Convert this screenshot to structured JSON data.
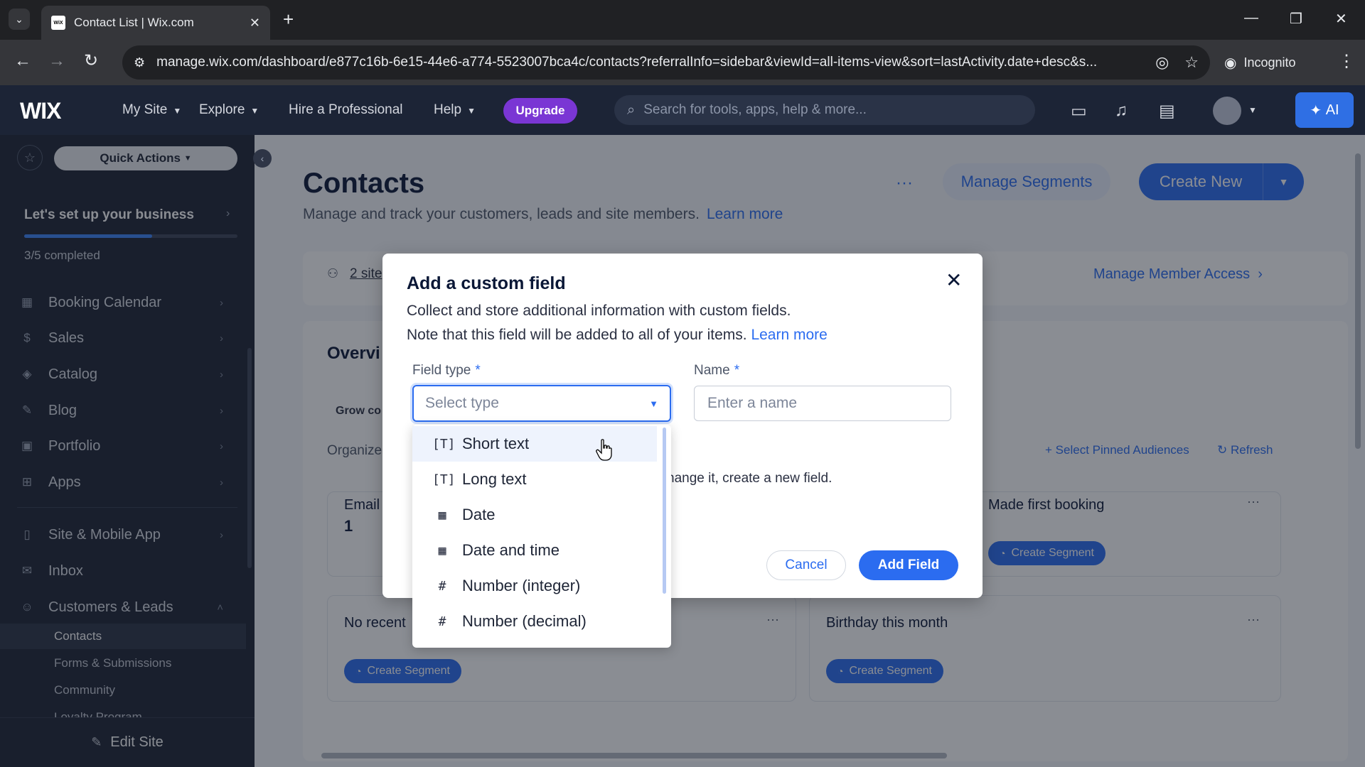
{
  "browser": {
    "tab_title": "Contact List | Wix.com",
    "favicon_text": "WiX",
    "url": "manage.wix.com/dashboard/e877c16b-6e15-44e6-a774-5523007bca4c/contacts?referralInfo=sidebar&viewId=all-items-view&sort=lastActivity.date+desc&s...",
    "incognito_label": "Incognito"
  },
  "topbar": {
    "logo": "WIX",
    "menu": [
      "My Site",
      "Explore",
      "Hire a Professional",
      "Help"
    ],
    "upgrade_label": "Upgrade",
    "search_placeholder": "Search for tools, apps, help & more...",
    "ai_label": "AI"
  },
  "sidebar": {
    "quick_actions": "Quick Actions",
    "setup_title": "Let's set up your business",
    "setup_progress": "3/5 completed",
    "setup_fraction": 0.6,
    "items": [
      {
        "label": "Booking Calendar",
        "icon": "calendar-icon"
      },
      {
        "label": "Sales",
        "icon": "dollar-icon"
      },
      {
        "label": "Catalog",
        "icon": "catalog-icon"
      },
      {
        "label": "Blog",
        "icon": "blog-icon"
      },
      {
        "label": "Portfolio",
        "icon": "portfolio-icon"
      },
      {
        "label": "Apps",
        "icon": "apps-icon"
      }
    ],
    "items2": [
      {
        "label": "Site & Mobile App",
        "icon": "mobile-icon"
      },
      {
        "label": "Inbox",
        "icon": "inbox-icon"
      },
      {
        "label": "Customers & Leads",
        "icon": "people-icon"
      }
    ],
    "sub_items": [
      "Contacts",
      "Forms & Submissions",
      "Community",
      "Loyalty Program"
    ],
    "edit_site": "Edit Site"
  },
  "main": {
    "title": "Contacts",
    "subtitle": "Manage and track your customers, leads and site members.",
    "learn_more": "Learn more",
    "manage_segments": "Manage Segments",
    "create_new": "Create New",
    "sites_link": "2 site",
    "manage_member_access": "Manage Member Access",
    "overview_title": "Overvi",
    "grow_label": "Grow co",
    "organize_label": "Organize",
    "select_pinned": "Select Pinned Audiences",
    "refresh": "Refresh",
    "cards": [
      {
        "title": "Email",
        "value": "1"
      },
      {
        "title": "Made first booking"
      },
      {
        "title": "No recent"
      },
      {
        "title": "Birthday this month"
      }
    ],
    "create_segment": "Create Segment"
  },
  "modal": {
    "title": "Add a custom field",
    "desc_line1": "Collect and store additional information with custom fields.",
    "desc_line2": "Note that this field will be added to all of your items.",
    "learn_more": "Learn more",
    "field_type_label": "Field type",
    "name_label": "Name",
    "required_mark": "*",
    "select_placeholder": "Select type",
    "name_placeholder": "Enter a name",
    "note_partial": "hange it, create a new field.",
    "cancel": "Cancel",
    "add_field": "Add Field",
    "options": [
      {
        "label": "Short text",
        "icon": "[T]"
      },
      {
        "label": "Long text",
        "icon": "[T]"
      },
      {
        "label": "Date",
        "icon": "▦"
      },
      {
        "label": "Date and time",
        "icon": "▦"
      },
      {
        "label": "Number (integer)",
        "icon": "#"
      },
      {
        "label": "Number (decimal)",
        "icon": "#"
      }
    ]
  }
}
